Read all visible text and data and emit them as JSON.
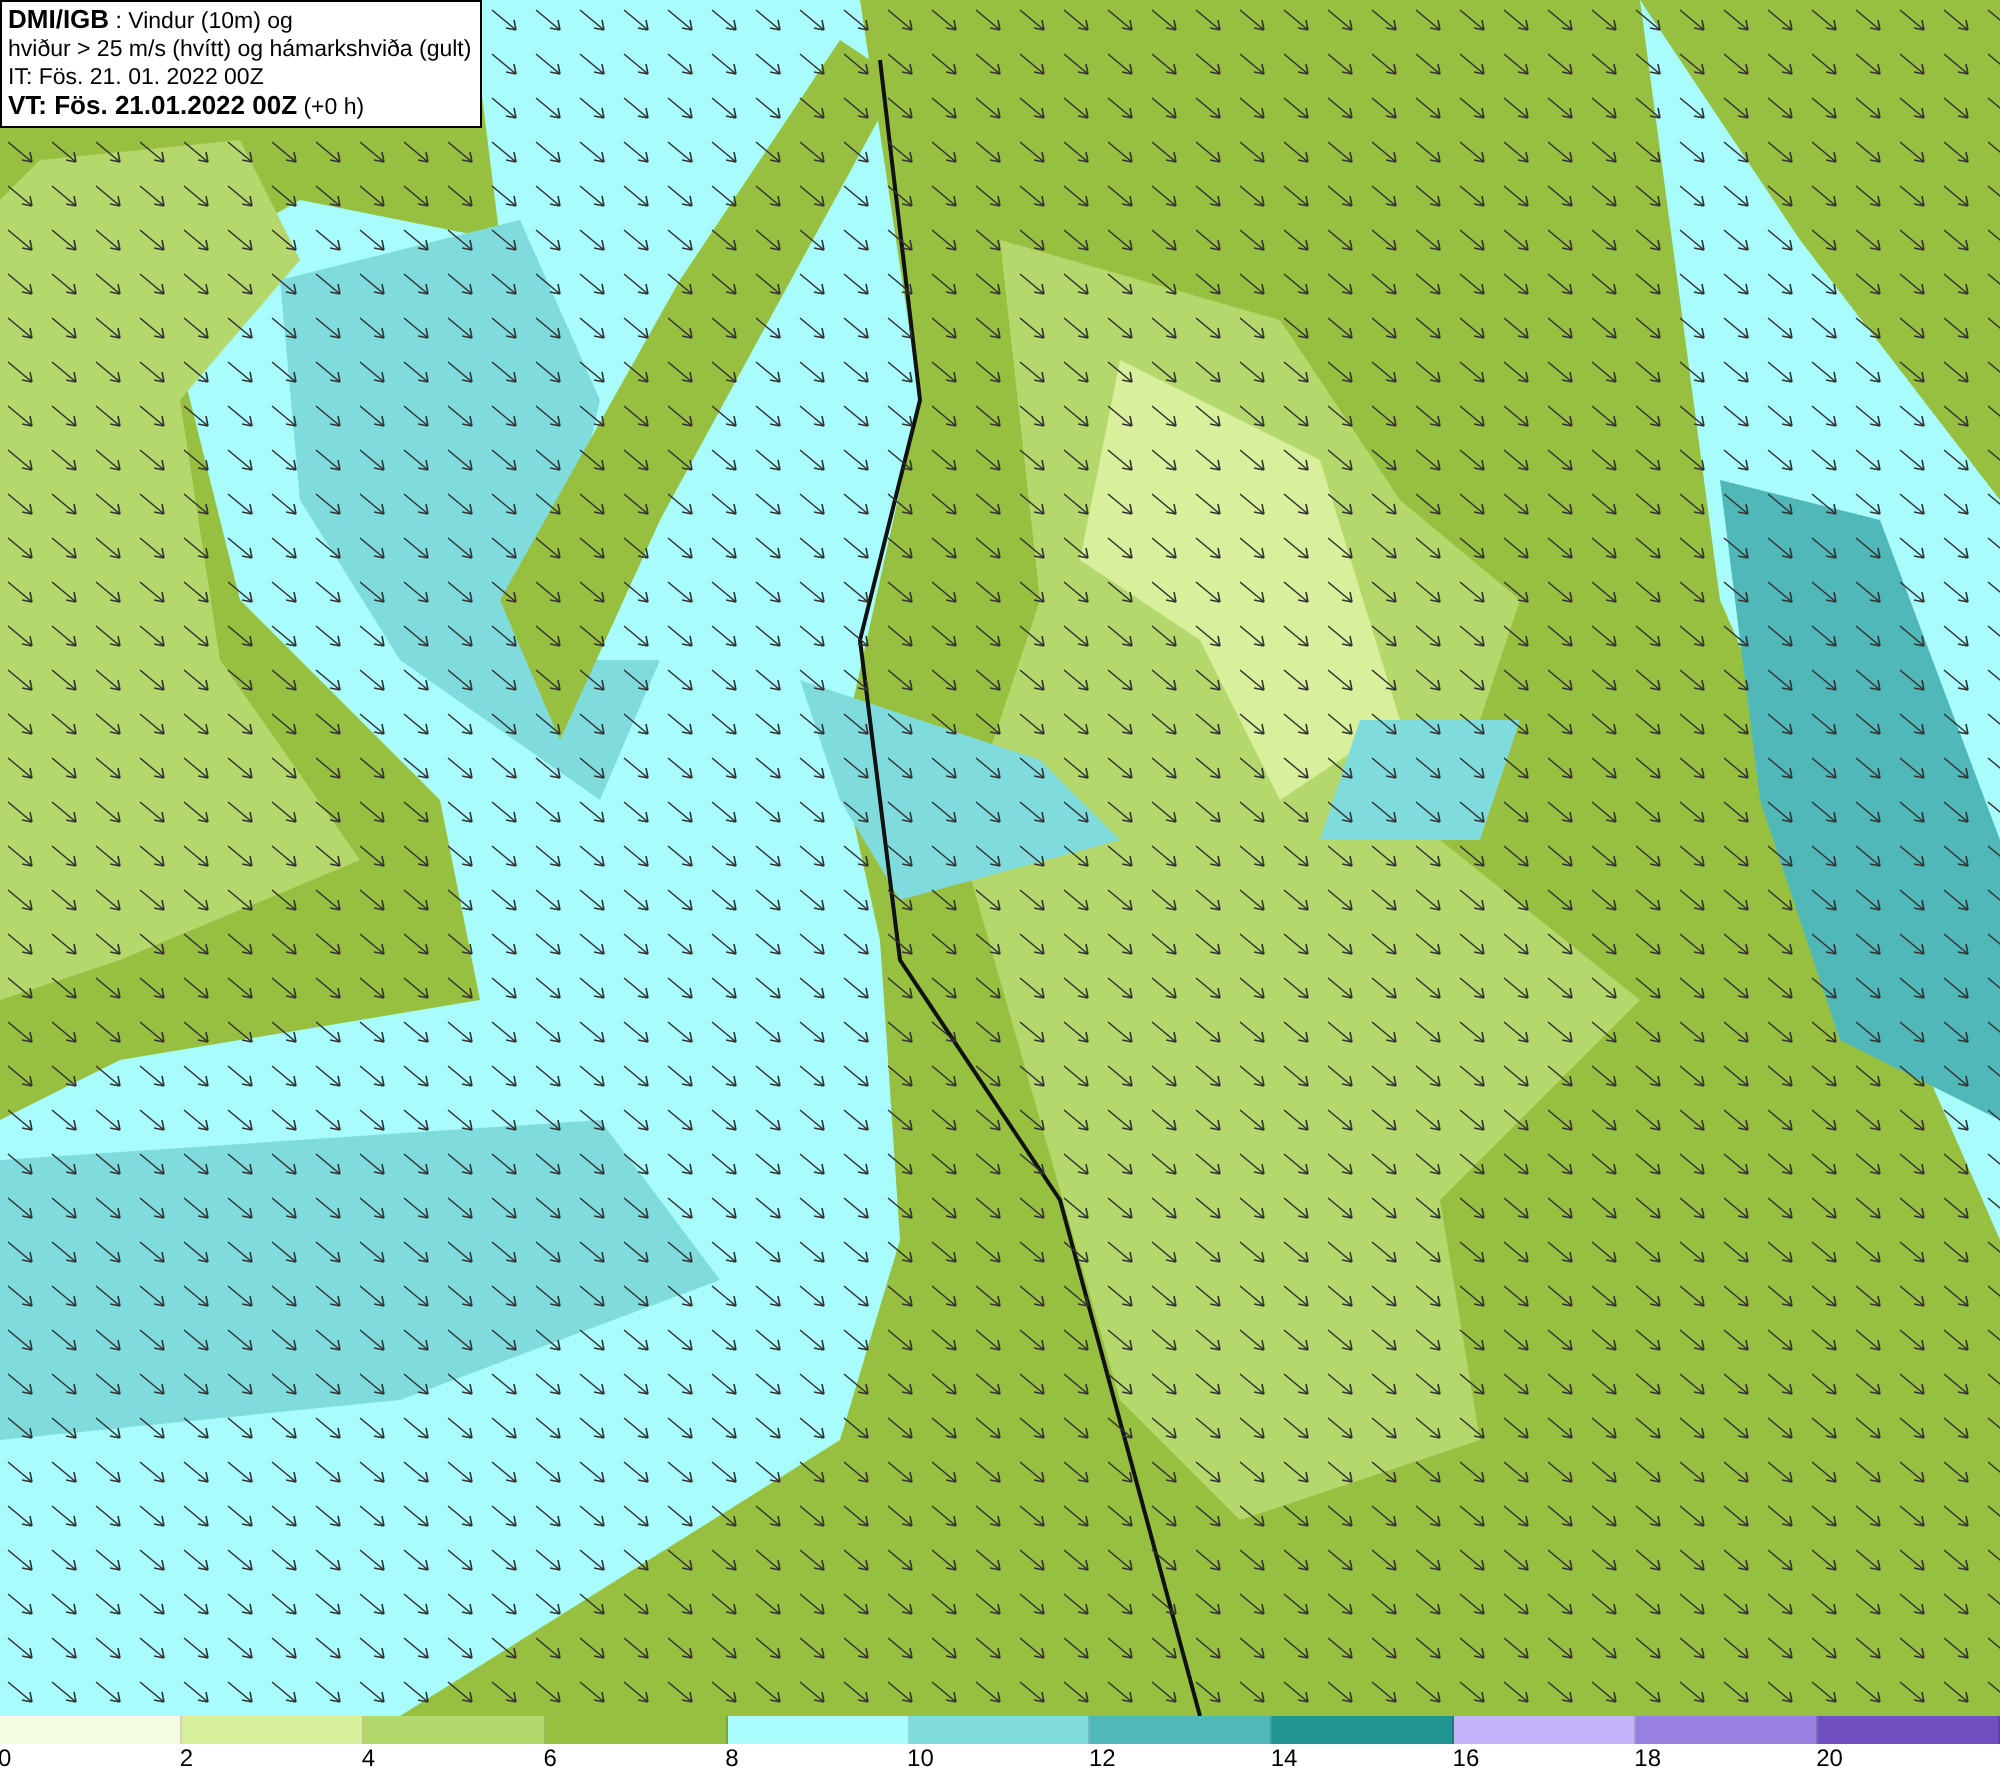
{
  "info_box": {
    "lines": [
      "**DMI/IGB** : Vindur (10m) og",
      "hviður > 25 m/s (hvítt) og hámarkshviða (gult)",
      "IT: Fös. 21. 01. 2022 00Z",
      "**VT: Fös. 21.01.2022 00Z** (+0 h)"
    ]
  },
  "legend": {
    "bins": [
      {
        "label": "0",
        "color": "#f4fce0"
      },
      {
        "label": "2",
        "color": "#d8f09c"
      },
      {
        "label": "4",
        "color": "#b4d86c"
      },
      {
        "label": "6",
        "color": "#98c040"
      },
      {
        "label": "8",
        "color": "#a8fcfc"
      },
      {
        "label": "10",
        "color": "#80dcdc"
      },
      {
        "label": "12",
        "color": "#50b8b8"
      },
      {
        "label": "14",
        "color": "#209490"
      },
      {
        "label": "16",
        "color": "#c4b4fc"
      },
      {
        "label": "18",
        "color": "#9880e0"
      },
      {
        "label": "20",
        "color": "#7050c0"
      }
    ]
  }
}
